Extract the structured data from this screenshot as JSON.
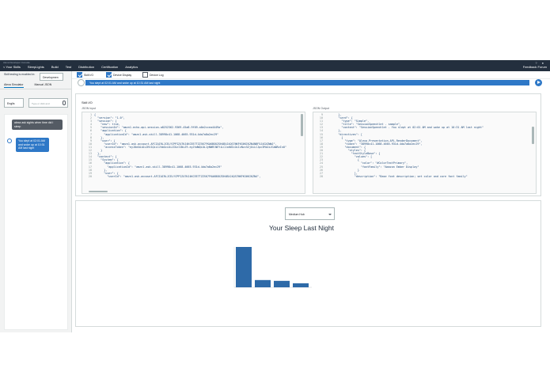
{
  "topbar": {
    "tiny_items": [
      "Alexa Developer Console"
    ],
    "menu": [
      "< Your Skills",
      "SleepLights",
      "Build",
      "Test",
      "Distribution",
      "Certification",
      "Analytics"
    ],
    "feedback": "Feedback Forum"
  },
  "sidebar": {
    "skill_note": "Skill testing is enabled in:",
    "stage_select": "Developmen",
    "tabs": [
      "Alexa Simulator",
      "Manual JSON"
    ],
    "language": "Englis",
    "input_placeholder": "Type or click and",
    "messages": {
      "user": "alexa ask sights when time did i sleep",
      "alexa": "You slept at 02:01 AM and woke up at 10:31 AM last night"
    }
  },
  "toolbar": {
    "skill_io": "Skill I/O",
    "device_display": "Device Display",
    "device_log": "Device Log"
  },
  "utterance": "You slept at 02:01 AM and woke up at 10:31 AM last night",
  "skill_io_panel": {
    "title": "Skill I/O",
    "json_input_label": "JSON Input",
    "json_output_label": "JSON Output",
    "input_start_line": 1,
    "input_lines": [
      "{",
      "  \"version\": \"1.0\",",
      "  \"session\": {",
      "    \"new\": true,",
      "    \"sessionId\": \"amzn1.echo-api.session.a8252362-9369-45a8-9f09-a0e2ccea4449a\",",
      "    \"application\": {",
      "      \"applicationId\": \"amzn1.ask.skill.38998c41-1068-4665-931d-4da7a8a2ec29\"",
      "    },",
      "    \"user\": {",
      "      \"userId\": \"amzn1.ask.account.AFCIAIRLJCELYCPPIZ47KJ4KCEE7TZZSK7FKAKBGKZSH4BXJ4QS7NKFKS6KIKZN4NBF5J4GXZWWJ\",",
      "      \"accessToken\": \"eyJ0eXAiOiJKV1QiLCJhbGciOiJIUzI1NiJ9.eyJhdWQiOiJyNWRlNEYiLCJzdWIiOiIzNzc5ZjUiLCJpc3MiOiJGaWRvIn0\"",
      "    }",
      "  },",
      "  \"context\": {",
      "    \"System\": {",
      "      \"application\": {",
      "        \"applicationId\": \"amzn1.ask.skill.38998c41-1068-4665-931d-4da7a8a2ec29\"",
      "      },",
      "      \"user\": {",
      "        \"userId\": \"amzn1.ask.account.AFCIAIRLJCELYCPPIZ47KJ4KCEE7TZZSK7FKAKBGKZSH4BXJ4QS7NKFKS6KIKZN4\","
    ],
    "output_start_line": 9,
    "output_lines": [
      "        },",
      "        \"card\": {",
      "          \"type\": \"Simple\",",
      "          \"title\": \"SessionSpeechlet - sample\",",
      "          \"content\": \"SessionSpeechlet - You slept at 02:01 AM and woke up at 10:31 AM last night\"",
      "        },",
      "        \"directives\": [",
      "          {",
      "            \"type\": \"Alexa.Presentation.APL.RenderDocument\",",
      "            \"token\": \"38998c41-1068-4665-931d-4da7a8a2ec29\",",
      "            \"document\": {",
      "              \"styles\": {",
      "                \"textStyleBase\": {",
      "                  \"values\": [",
      "                    {",
      "                      \"color\": \"#ColorTextPrimary\",",
      "                      \"fontFamily\": \"Amazon Ember Display\"",
      "                    }",
      "                  ],",
      "                  \"description\": \"Base font description; set color and core font family\""
    ]
  },
  "device_display": {
    "device_select": "Medium Hub",
    "title": "Your Sleep Last Night"
  },
  "chart_data": {
    "type": "bar",
    "title": "Your Sleep Last Night",
    "categories": [
      "",
      "",
      "",
      ""
    ],
    "values": [
      100,
      18,
      16,
      10
    ],
    "ylim": [
      0,
      100
    ],
    "bar_color": "#2e6aa8",
    "grid": false,
    "legend": "none"
  },
  "colors": {
    "header": "#232f3e",
    "accent": "#2e78c7",
    "user_bubble": "#545b64"
  }
}
